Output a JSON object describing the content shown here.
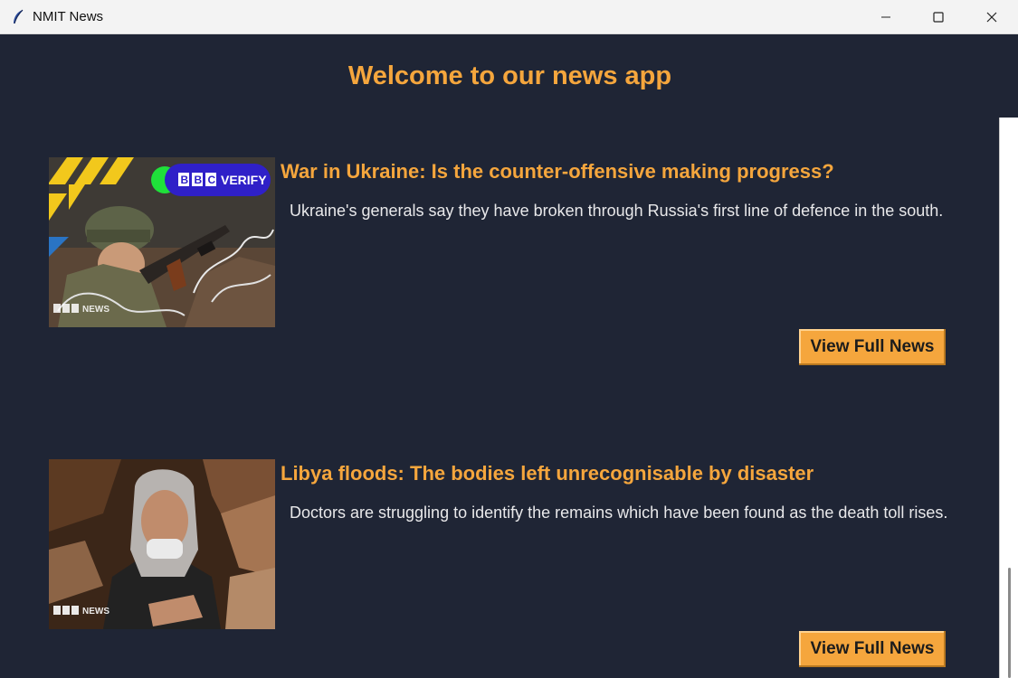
{
  "window": {
    "title": "NMIT News",
    "icon": "feather-icon",
    "controls": [
      "minimize-icon",
      "maximize-icon",
      "close-icon"
    ]
  },
  "header": {
    "welcome": "Welcome to our news app"
  },
  "articles": [
    {
      "headline": "War in Ukraine: Is the counter-offensive making progress?",
      "summary": "Ukraine's generals say they have broken through Russia's first line of defence in the south.",
      "button_label": "View Full News",
      "image": {
        "badge": "BBC VERIFY",
        "watermark": "BBC NEWS"
      }
    },
    {
      "headline": "Libya floods: The bodies left unrecognisable by disaster",
      "summary": "Doctors are struggling to identify the remains which have been found as the death toll rises.",
      "button_label": "View Full News",
      "image": {
        "watermark": "BBC NEWS"
      }
    }
  ],
  "colors": {
    "background": "#1f2535",
    "accent": "#f5a63d",
    "text": "#e8e8ea"
  }
}
